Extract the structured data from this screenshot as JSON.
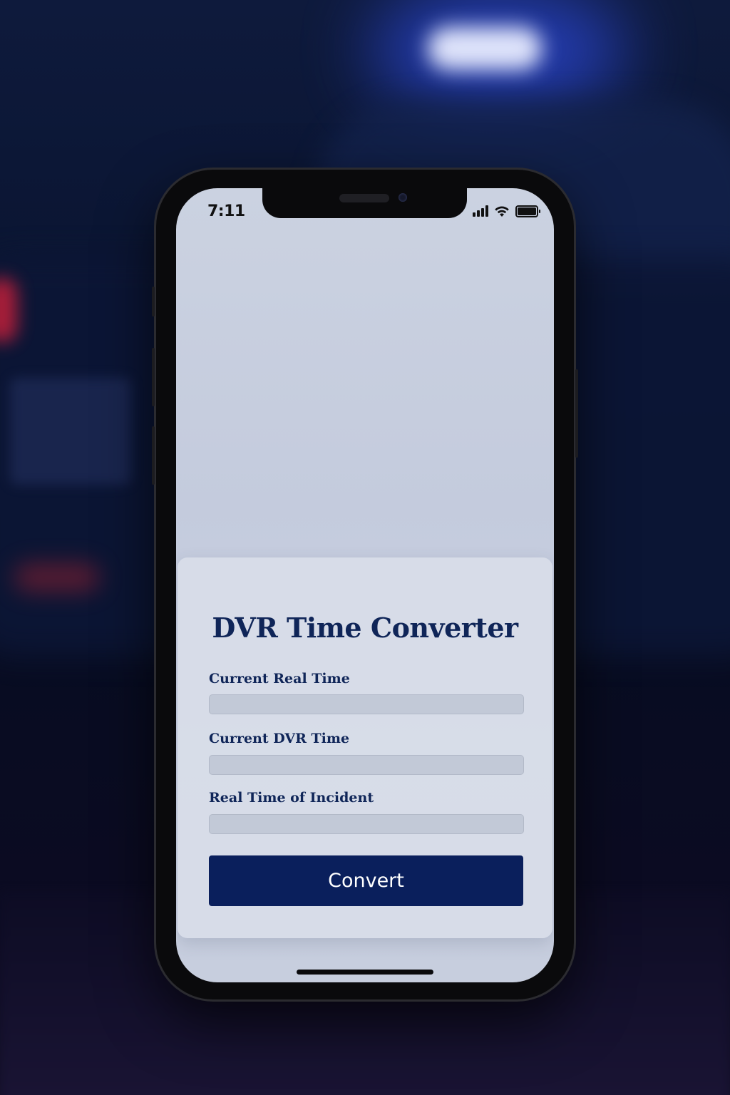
{
  "status_bar": {
    "time": "7:11",
    "icons": [
      "cellular-signal-icon",
      "wifi-icon",
      "battery-icon"
    ]
  },
  "app": {
    "title": "DVR Time Converter",
    "fields": [
      {
        "label": "Current Real Time",
        "value": ""
      },
      {
        "label": "Current DVR Time",
        "value": ""
      },
      {
        "label": "Real Time of Incident",
        "value": ""
      }
    ],
    "convert_label": "Convert"
  },
  "colors": {
    "accent": "#0a1f5c",
    "title_text": "#0f2558",
    "screen_background": "#c9d0e2"
  }
}
